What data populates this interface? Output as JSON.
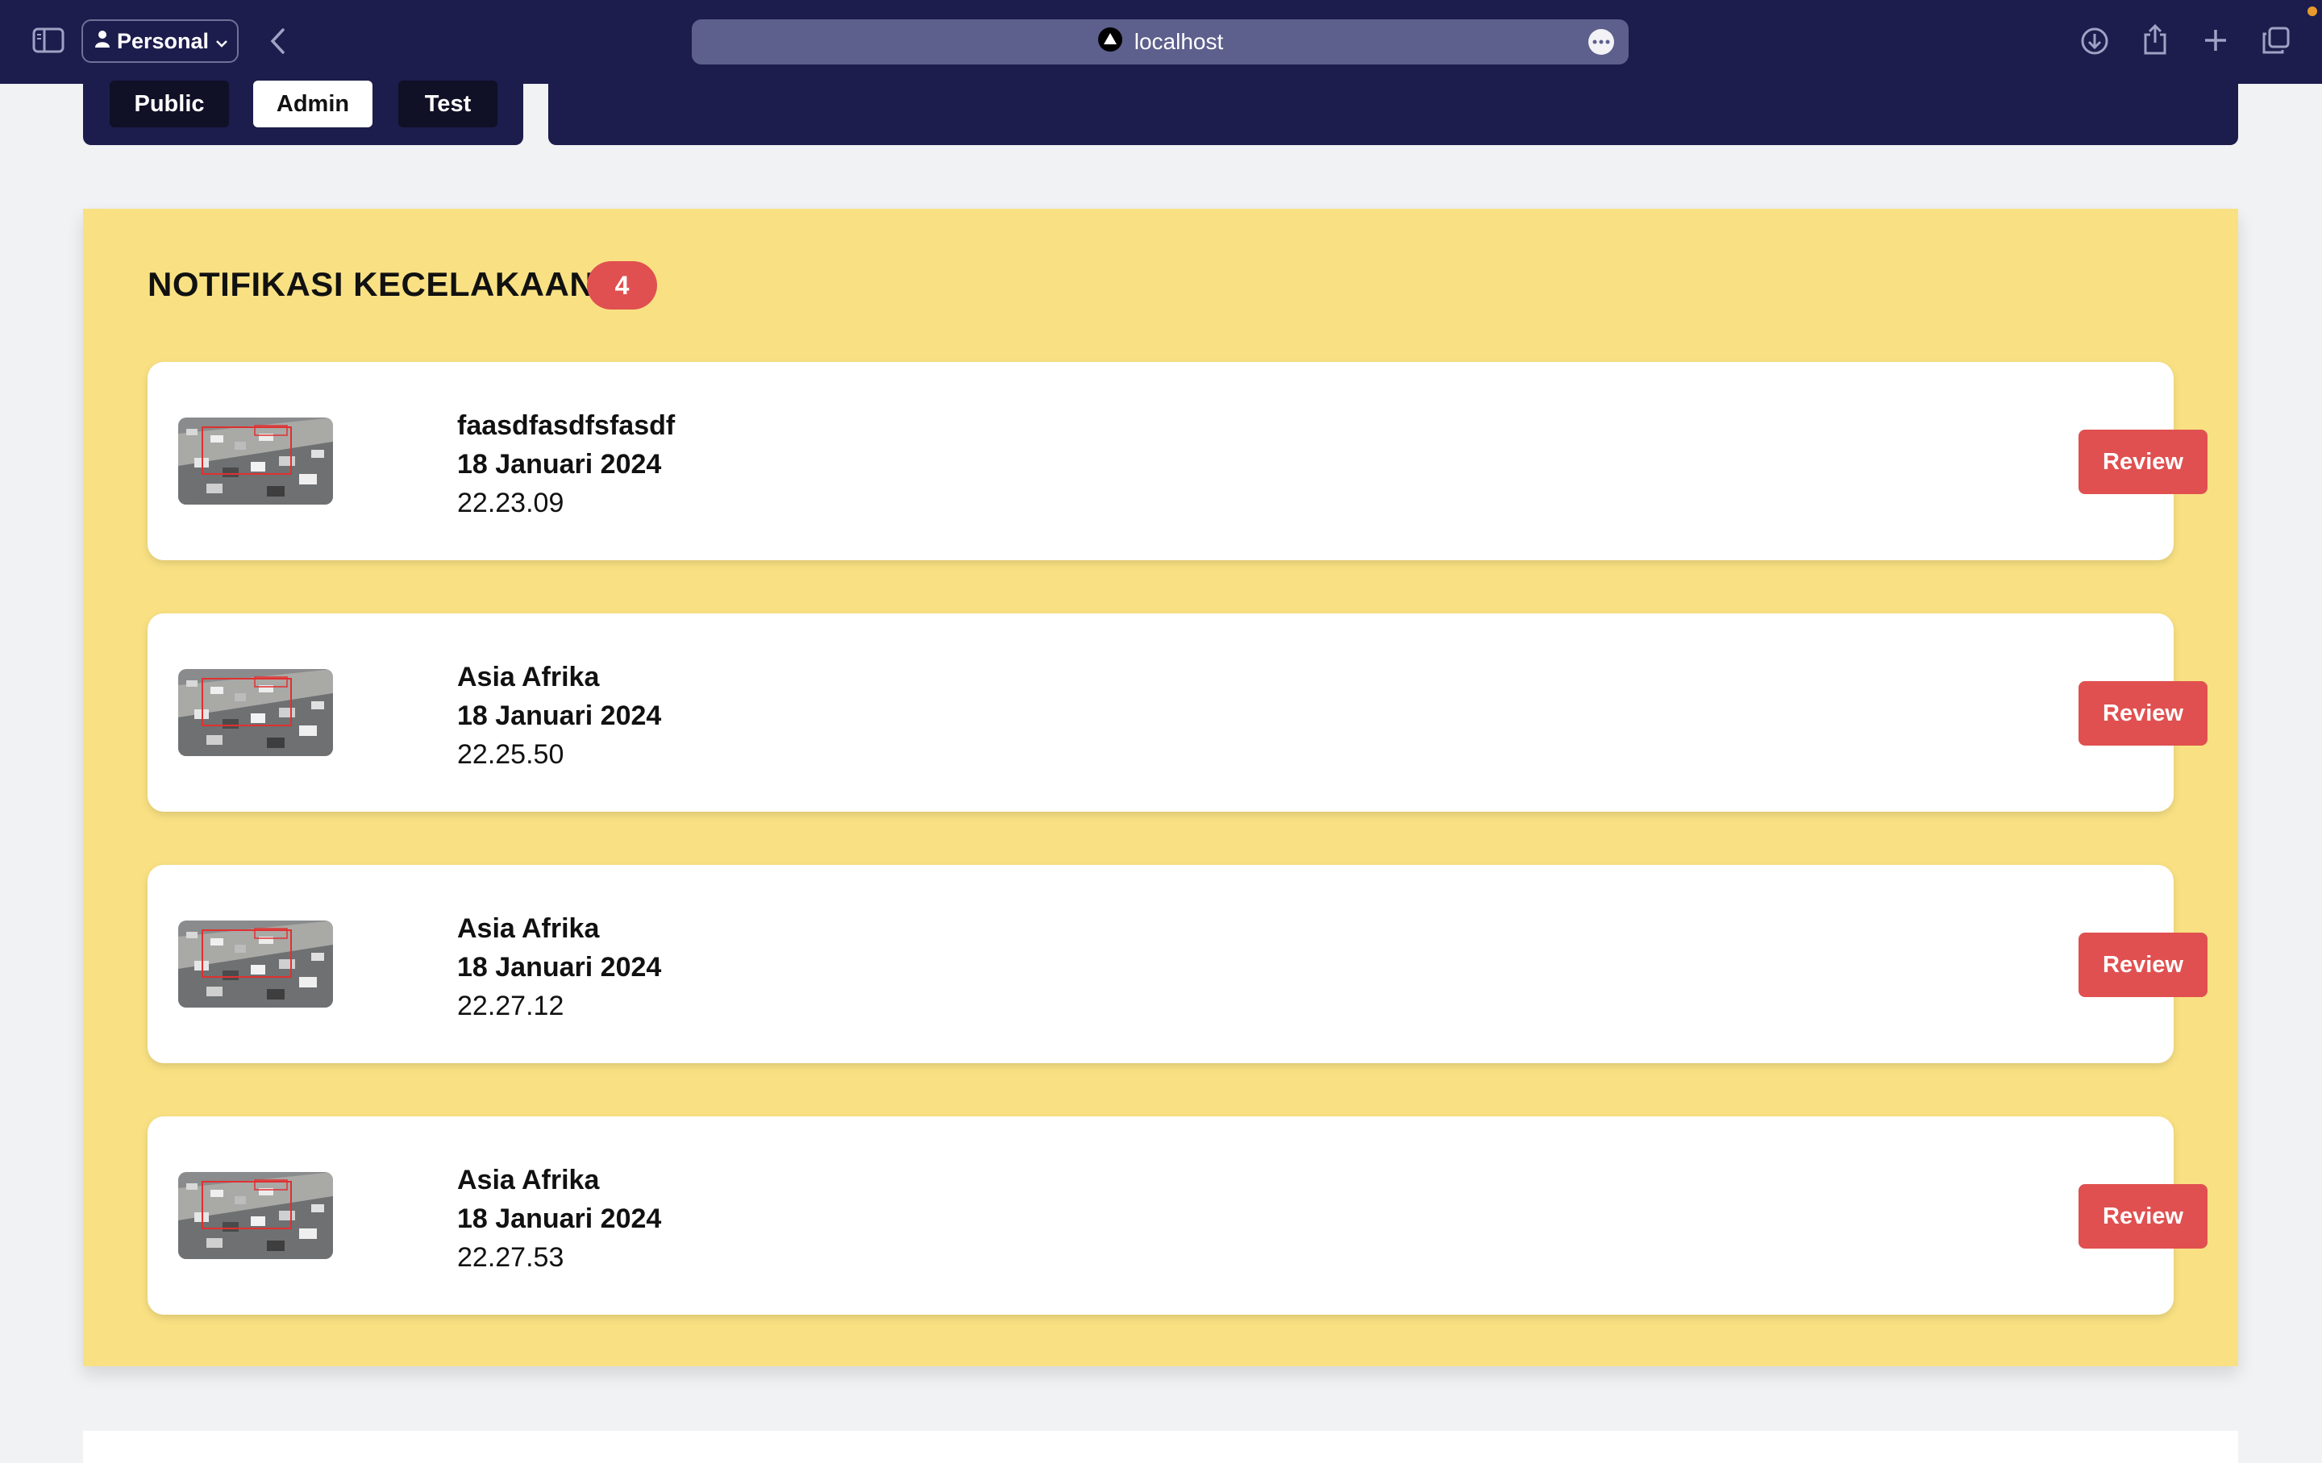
{
  "browser": {
    "profile_label": "Personal",
    "url": "localhost"
  },
  "nav": {
    "tabs": [
      {
        "label": "Public",
        "active": false
      },
      {
        "label": "Admin",
        "active": true
      },
      {
        "label": "Test",
        "active": false
      }
    ]
  },
  "notifications": {
    "title": "NOTIFIKASI KECELAKAAN",
    "count": "4",
    "items": [
      {
        "location": "faasdfasdfsfasdf",
        "date": "18 Januari 2024",
        "time": "22.23.09",
        "button_label": "Review"
      },
      {
        "location": "Asia Afrika",
        "date": "18 Januari 2024",
        "time": "22.25.50",
        "button_label": "Review"
      },
      {
        "location": "Asia Afrika",
        "date": "18 Januari 2024",
        "time": "22.27.12",
        "button_label": "Review"
      },
      {
        "location": "Asia Afrika",
        "date": "18 Januari 2024",
        "time": "22.27.53",
        "button_label": "Review"
      }
    ]
  },
  "colors": {
    "toolbar": "#1c1c4d",
    "section_bg": "#f9e183",
    "accent_red": "#e05050"
  },
  "icons": [
    "sidebar-icon",
    "person-icon",
    "chevron-down-icon",
    "back-icon",
    "site-icon",
    "more-icon",
    "download-icon",
    "share-icon",
    "plus-icon",
    "tabs-icon"
  ]
}
